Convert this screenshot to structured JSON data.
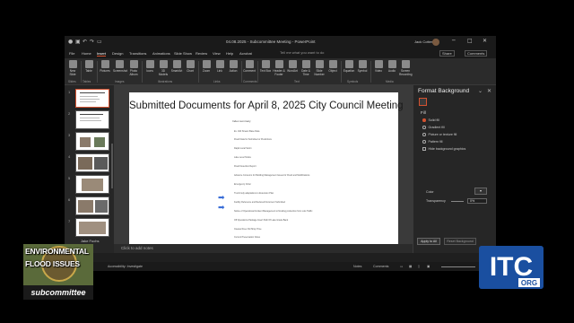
{
  "window": {
    "doc_title": "04.08.2025 - Subcommittee Meeting - PowerPoint",
    "user_name": "Jack Cotter",
    "win_controls": [
      "─",
      "□",
      "✕"
    ]
  },
  "menu_tabs": [
    "File",
    "Home",
    "Insert",
    "Design",
    "Transitions",
    "Animations",
    "Slide Show",
    "Review",
    "View",
    "Help",
    "Acrobat"
  ],
  "active_tab": "Insert",
  "search_placeholder": "Tell me what you want to do",
  "tab_right": [
    "Share",
    "Comments"
  ],
  "ribbon": {
    "buttons": [
      "New Slide",
      "Table",
      "Pictures",
      "Screenshot",
      "Photo Album",
      "Icons",
      "3D Models",
      "SmartArt",
      "Chart",
      "Zoom",
      "Link",
      "Action",
      "Comment",
      "Text Box",
      "Header & Footer",
      "WordArt",
      "Date & Time",
      "Slide Number",
      "Object",
      "Equation",
      "Symbol",
      "Video",
      "Audio",
      "Screen Recording"
    ],
    "groups": [
      "Slides",
      "Tables",
      "Images",
      "Illustrations",
      "Links",
      "Comments",
      "Text",
      "Symbols",
      "Media"
    ]
  },
  "thumbnails": {
    "numbers": [
      "1",
      "2",
      "3",
      "4",
      "5",
      "6",
      "7"
    ],
    "caption": "Jake Fuchs"
  },
  "slide": {
    "title": "Submitted Documents for April 8, 2025 City Council Meeting",
    "subtitle": "Index summary",
    "items": [
      "Ex. 024 Stream Base Data",
      "Flood Data for Submitted or Predictions",
      "Rapid Local Storm",
      "Lake Level Notice",
      "Flood Detection Report",
      "Advance Concerns for Building Management Issues for Flood and Modifications",
      "Emergency Order",
      "Truck body adaptations to Extension Plan",
      "Facility Reference and Reduced Document Submitted",
      "Notice of Operational Incident Management to flooding production from Lots Traffic",
      "Off Operations Package Insert Path Of Lake Grade Bank",
      "Cleared Free Old Shop Time",
      "Current Preservation Notes"
    ]
  },
  "notes_placeholder": "Click to add notes",
  "format_pane": {
    "title": "Format Background",
    "fill_label": "Fill",
    "options": [
      "Solid fill",
      "Gradient fill",
      "Picture or texture fill",
      "Pattern fill",
      "Hide background graphics"
    ],
    "selected_option": "Solid fill",
    "color_label": "Color",
    "transparency_label": "Transparency",
    "transparency_value": "0%",
    "apply_all": "Apply to All",
    "reset": "Reset Background"
  },
  "status_bar": {
    "slide_info": "Slide 1 of 11",
    "accessibility": "Accessibility: Investigate",
    "notes": "Notes",
    "comments": "Comments",
    "zoom": "86%"
  },
  "overlay": {
    "line1": "ENVIRONMENTAL",
    "line2": "FLOOD ISSUES",
    "subcommittee": "subcommittee",
    "channel_logo": "ITC.ORG",
    "colors": {
      "itc_blue": "#1a4fa0",
      "accent": "#d35230"
    }
  }
}
